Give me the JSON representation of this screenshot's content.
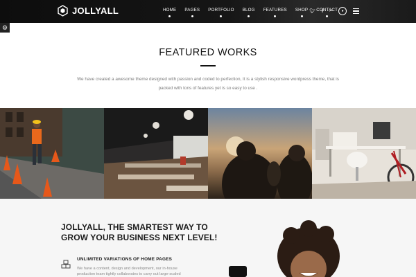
{
  "header": {
    "logo_text": "JOLLYALL",
    "nav": [
      "HOME",
      "PAGES",
      "PORTFOLIO",
      "BLOG",
      "FEATURES",
      "SHOP",
      "CONTACT"
    ],
    "icons": [
      "twitter-icon",
      "facebook-icon",
      "search-icon",
      "cart-icon",
      "menu-icon"
    ]
  },
  "settings_icon": "gear-icon",
  "featured": {
    "title": "FEATURED WORKS",
    "intro_line1": "We have created a awesome theme designed with passion and coded to perfection, It is a stylish responsive wordpress theme, that is",
    "intro_line2": "packed with tons of features yet is so easy to use ."
  },
  "gallery": {
    "tiles": [
      "construction-worker-photo",
      "restaurant-interior-photo",
      "sunset-group-photo",
      "office-desk-bicycle-photo"
    ]
  },
  "promo": {
    "headline_line1": "JOLLYALL, THE SMARTEST WAY TO",
    "headline_line2": "GROW YOUR BUSINESS NEXT LEVEL!",
    "feature_title": "UNLIMITED VARIATIONS OF HOME PAGES",
    "feature_text_line1": "We have a content, design and development, our in-house",
    "feature_text_line2": "production team tightly collaborates to carry out large-scaled"
  },
  "colors": {
    "header_bg": "#111111",
    "accent": "#111111",
    "muted_text": "#7a7a7a"
  }
}
